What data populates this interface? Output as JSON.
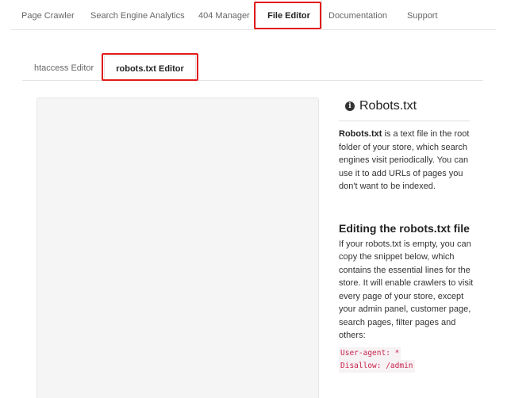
{
  "top_nav": {
    "tabs": [
      {
        "label": "Page Crawler",
        "active": false
      },
      {
        "label": "Search Engine Analytics",
        "active": false
      },
      {
        "label": "404 Manager",
        "active": false
      },
      {
        "label": "File Editor",
        "active": true
      },
      {
        "label": "Documentation",
        "active": false
      },
      {
        "label": "Support",
        "active": false
      }
    ]
  },
  "sub_nav": {
    "tabs": [
      {
        "label": "htaccess Editor",
        "active": false
      },
      {
        "label": "robots.txt Editor",
        "active": true
      }
    ]
  },
  "sidebar": {
    "title": "Robots.txt",
    "title_icon": "info-circle-icon",
    "intro_bold": "Robots.txt",
    "intro_rest": " is a text file in the root folder of your store, which search engines visit periodically. You can use it to add URLs of pages you don't want to be indexed.",
    "heading": "Editing the robots.txt file",
    "body": "If your robots.txt is empty, you can copy the snippet below, which contains the essential lines for the store. It will enable crawlers to visit every page of your store, except your admin panel, customer page, search pages, filter pages and others:",
    "code_lines": [
      "User-agent: *",
      "Disallow: /admin"
    ]
  },
  "colors": {
    "highlight": "#e21b1b",
    "code_text": "#c7254e",
    "code_bg": "#f7f2f4"
  }
}
